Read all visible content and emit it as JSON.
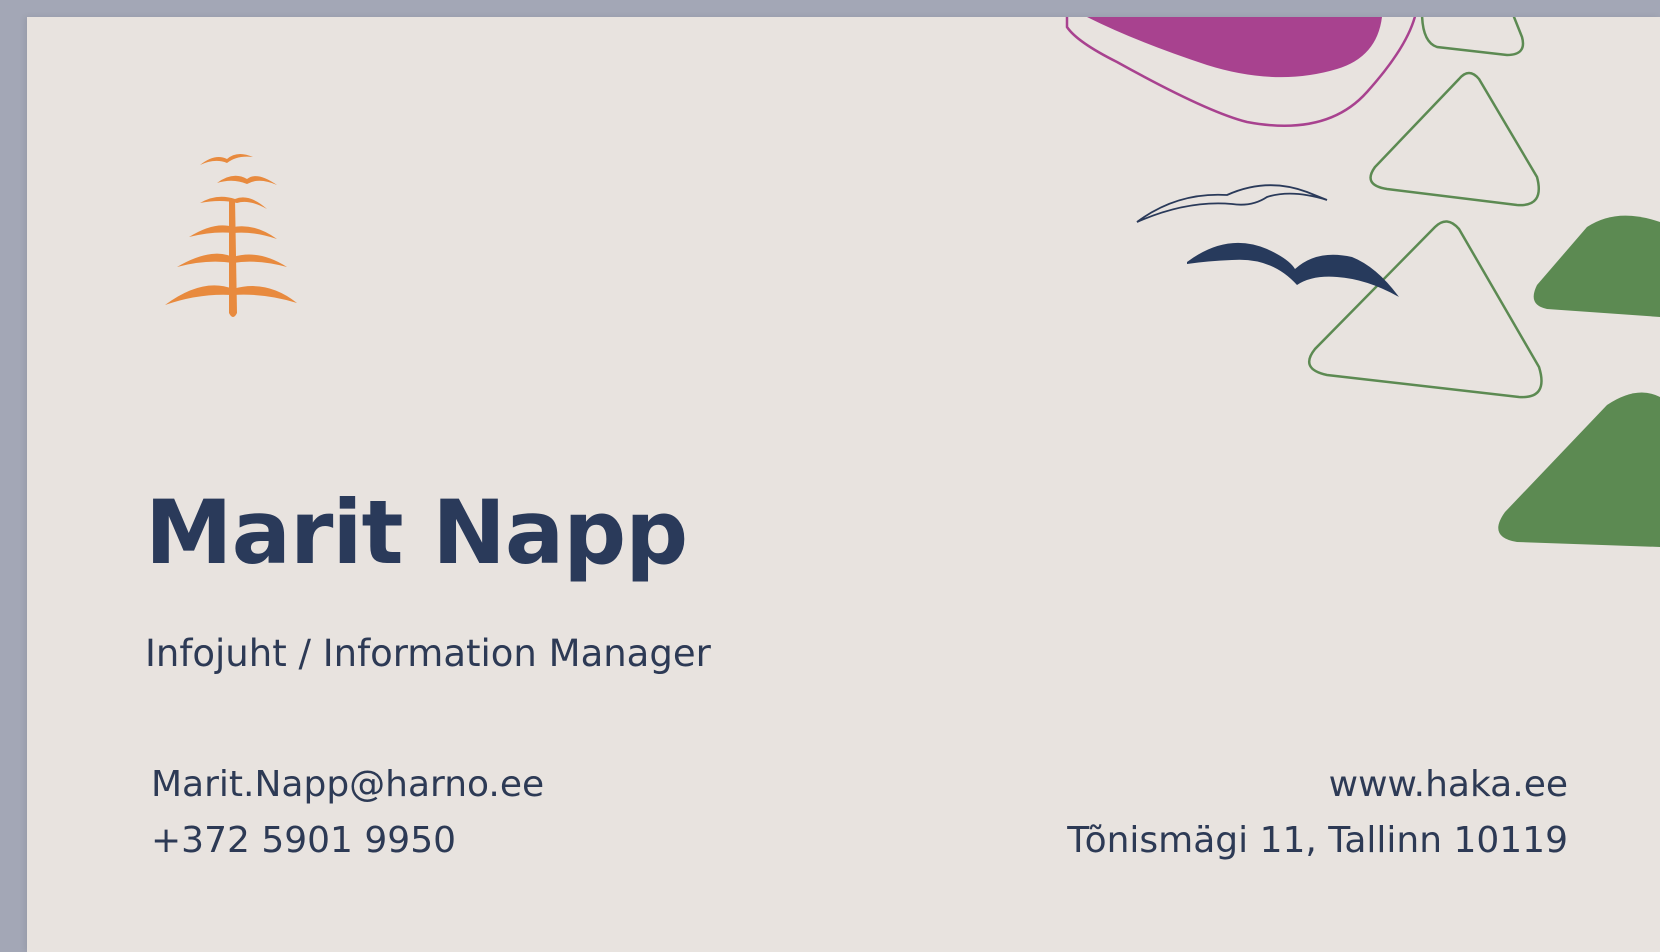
{
  "card": {
    "name": "Marit Napp",
    "title": "Infojuht / Information Manager",
    "email": "Marit.Napp@harno.ee",
    "phone": "+372 5901 9950",
    "website": "www.haka.ee",
    "address": "Tõnismägi 11, Tallinn 10119"
  },
  "colors": {
    "text": "#2a3a5a",
    "logo": "#e88a3e",
    "magenta": "#a8428f",
    "green": "#5c8a52",
    "bird_dark": "#273a5c",
    "card": "#e8e3df",
    "backdrop": "#a3a7b6"
  },
  "icons": {
    "logo": "tree-with-birds-icon",
    "birds": "bird-icon"
  }
}
